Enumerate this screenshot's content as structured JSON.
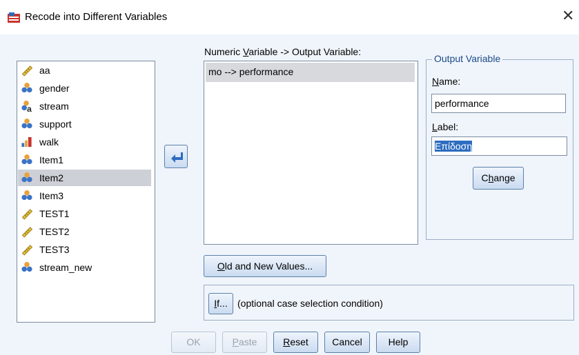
{
  "window": {
    "title": "Recode into Different Variables",
    "close_glyph": "✕"
  },
  "variables": [
    {
      "name": "aa",
      "icon": "ruler-icon",
      "selected": false
    },
    {
      "name": "gender",
      "icon": "nominal-icon",
      "selected": false
    },
    {
      "name": "stream",
      "icon": "string-nominal-icon",
      "selected": false
    },
    {
      "name": "support",
      "icon": "nominal-icon",
      "selected": false
    },
    {
      "name": "walk",
      "icon": "ordinal-icon",
      "selected": false
    },
    {
      "name": "Item1",
      "icon": "nominal-icon",
      "selected": false
    },
    {
      "name": "Item2",
      "icon": "nominal-icon",
      "selected": true
    },
    {
      "name": "Item3",
      "icon": "nominal-icon",
      "selected": false
    },
    {
      "name": "TEST1",
      "icon": "ruler-icon",
      "selected": false
    },
    {
      "name": "TEST2",
      "icon": "ruler-icon",
      "selected": false
    },
    {
      "name": "TEST3",
      "icon": "ruler-icon",
      "selected": false
    },
    {
      "name": "stream_new",
      "icon": "nominal-icon",
      "selected": false
    }
  ],
  "numeric_panel": {
    "label_pre": "Numeric ",
    "label_mnemonic": "V",
    "label_post": "ariable -> Output Variable:",
    "items": [
      "mo --> performance"
    ]
  },
  "output_variable": {
    "group_title": "Output Variable",
    "name_label_mnemonic": "N",
    "name_label_rest": "ame:",
    "name_value": "performance",
    "label_label_mnemonic": "L",
    "label_label_rest": "abel:",
    "label_value": "Επίδοση",
    "change_pre": "C",
    "change_mnemonic": "h",
    "change_post": "ange"
  },
  "old_new_button": {
    "mnemonic": "O",
    "rest": "ld and New Values..."
  },
  "if_section": {
    "button_mnemonic": "I",
    "button_rest": "f...",
    "text": "(optional case selection condition)"
  },
  "buttons": {
    "ok": "OK",
    "paste_mnemonic": "P",
    "paste_rest": "aste",
    "reset_mnemonic": "R",
    "reset_rest": "eset",
    "cancel": "Cancel",
    "help": "Help"
  },
  "colors": {
    "accent": "#2d6cc0",
    "background": "#f0f5fb",
    "selection": "#cdd0d6"
  }
}
